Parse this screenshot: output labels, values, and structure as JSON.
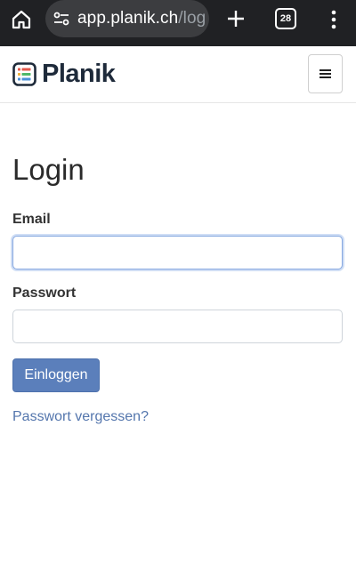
{
  "browser": {
    "url_domain": "app.planik.ch",
    "url_path": "/log",
    "tab_count": "28"
  },
  "navbar": {
    "brand": "Planik",
    "logo_colors": [
      "#e3584b",
      "#f2b33d",
      "#4fb86a",
      "#4a90d9"
    ]
  },
  "login": {
    "title": "Login",
    "email_label": "Email",
    "email_value": "",
    "password_label": "Passwort",
    "password_value": "",
    "submit_label": "Einloggen",
    "forgot_link": "Passwort vergessen?"
  },
  "colors": {
    "primary": "#5b7fbb",
    "link": "#5476ad",
    "brand_text": "#1e2a3a"
  }
}
